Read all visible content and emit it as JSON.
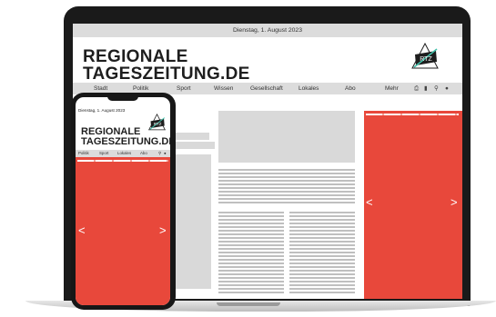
{
  "desktop": {
    "date": "Dienstag, 1. August 2023",
    "logo_line1": "REGIONALE",
    "logo_line2": "TAGESZEITUNG.DE",
    "badge": "RTZ",
    "nav": [
      "Stadt",
      "Politik",
      "Sport",
      "Wissen",
      "Gesellschaft",
      "Lokales",
      "Abo",
      "Mehr"
    ]
  },
  "mobile": {
    "date": "Dienstag, 1. August 2023",
    "logo_line1": "REGIONALE",
    "logo_line2": "TAGESZEITUNG.DE",
    "badge": "RTZ",
    "nav": [
      "Politik",
      "Sport",
      "Lokales",
      "Abo"
    ]
  },
  "icons": [
    "print-icon",
    "bookmark-icon",
    "search-icon",
    "user-icon"
  ],
  "slider": {
    "prev": "<",
    "next": ">"
  },
  "colors": {
    "accent": "#e8483b",
    "bar": "#dcdcdc",
    "frame": "#1a1a1a"
  }
}
